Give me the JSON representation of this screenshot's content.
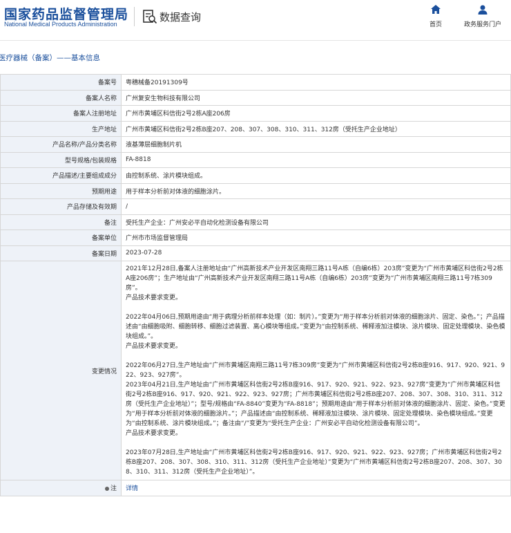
{
  "header": {
    "logo_cn": "国家药品监督管理局",
    "logo_en": "National Medical Products Administration",
    "query_label": "数据查询",
    "nav": [
      {
        "label": "首页",
        "icon": "home-icon"
      },
      {
        "label": "政务服务门户",
        "icon": "user-icon"
      }
    ]
  },
  "breadcrumb": "医疗器械（备案）——基本信息",
  "rows": [
    {
      "key": "备案号",
      "value": "粤穗械备20191309号"
    },
    {
      "key": "备案人名称",
      "value": "广州复安生物科技有限公司"
    },
    {
      "key": "备案人注册地址",
      "value": "广州市黄埔区科信街2号2栋A座206房"
    },
    {
      "key": "生产地址",
      "value": "广州市黄埔区科信街2号2栋B座207、208、307、308、310、311、312房（受托生产企业地址）"
    },
    {
      "key": "产品名称/产品分类名称",
      "value": "液基薄层细胞制片机"
    },
    {
      "key": "型号规格/包装规格",
      "value": "FA-8818"
    },
    {
      "key": "产品描述/主要组成成分",
      "value": "由控制系统、涂片模块组成。"
    },
    {
      "key": "预期用途",
      "value": "用于样本分析前对体液的细胞涂片。"
    },
    {
      "key": "产品存储及有效期",
      "value": "/"
    },
    {
      "key": "备注",
      "value": "受托生产企业：广州安必平自动化检测设备有限公司"
    },
    {
      "key": "备案单位",
      "value": "广州市市场监督管理局"
    },
    {
      "key": "备案日期",
      "value": "2023-07-28"
    }
  ],
  "change": {
    "key": "变更情况",
    "blocks": [
      "2021年12月28日,备案人注册地址由“广州高新技术产业开发区南翔三路11号A栋（自编6栋）203房”变更为“广州市黄埔区科信街2号2栋A座206房”；生产地址由“广州高新技术产业开发区南翔三路11号A栋（自编6栋）203房”变更为“广州市黄埔区南翔三路11号7栋309房”。\n产品技术要求变更。",
      "2022年04月06日,预期用途由“用于病理分析前样本处理（如：制片）。”变更为“用于样本分析前对体液的细胞涂片、固定、染色。”；产品描述由“由细胞吸附、细胞转移、细胞过滤装置、离心模块等组成。”变更为“由控制系统、稀释液加注模块、涂片模块、固定处理模块、染色模块组成。”。\n产品技术要求变更。",
      "2022年06月27日,生产地址由“广州市黄埔区南翔三路11号7栋309房”变更为“广州市黄埔区科信街2号2栋B座916、917、920、921、922、923、927房”。\n2023年04月21日,生产地址由“广州市黄埔区科信街2号2栋B座916、917、920、921、922、923、927房”变更为“广州市黄埔区科信街2号2栋B座916、917、920、921、922、923、927房；广州市黄埔区科信街2号2栋B座207、208、307、308、310、311、312房（受托生产企业地址）”；型号/规格由“FA-8840”变更为“FA-8818”；预期用途由“用于样本分析前对体液的细胞涂片、固定、染色。”变更为“用于样本分析前对体液的细胞涂片。”；产品描述由“由控制系统、稀释液加注模块、涂片模块、固定处理模块、染色模块组成。”变更为“由控制系统、涂片模块组成。”；备注由“/”变更为“受托生产企业：广州安必平自动化检测设备有限公司”。\n产品技术要求变更。",
      "2023年07月28日,生产地址由“广州市黄埔区科信街2号2栋B座916、917、920、921、922、923、927房；广州市黄埔区科信街2号2栋B座207、208、307、308、310、311、312房（受托生产企业地址）”变更为“广州市黄埔区科信街2号2栋B座207、208、307、308、310、311、312房（受托生产企业地址）”。"
    ]
  },
  "note": {
    "key": "注",
    "link": "详情"
  }
}
